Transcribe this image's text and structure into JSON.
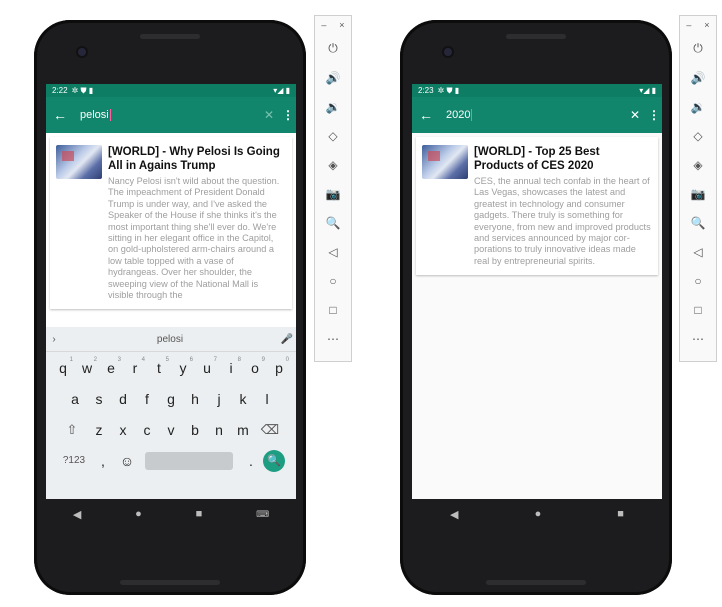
{
  "left_phone": {
    "status": {
      "time": "2:22",
      "left_icons": "✲ ⛊ ▮",
      "right_icons": "▾◢ ▮"
    },
    "search": {
      "query": "pelosi"
    },
    "article": {
      "title": "[WORLD] - Why Pelosi Is Going All in Agains Trump",
      "body": "Nancy Pelosi isn't wild about the question. The impeachment of President Donald Trump is under way, and I've asked the Speaker of the House if she thinks it's the most important thing she'll ever do. We're sitting in her elegant office in the Capitol, on gold-upholstered arm-chairs around a low table topped with a vase of hydrangeas. Over her shoulder, the sweeping view of the National Mall is visible through the"
    },
    "keyboard": {
      "suggestion": "pelosi",
      "row1": [
        "q",
        "w",
        "e",
        "r",
        "t",
        "y",
        "u",
        "i",
        "o",
        "p"
      ],
      "row1_hints": [
        "1",
        "2",
        "3",
        "4",
        "5",
        "6",
        "7",
        "8",
        "9",
        "0"
      ],
      "row2": [
        "a",
        "s",
        "d",
        "f",
        "g",
        "h",
        "j",
        "k",
        "l"
      ],
      "row3": [
        "z",
        "x",
        "c",
        "v",
        "b",
        "n",
        "m"
      ],
      "shift": "⇧",
      "backspace": "⌫",
      "symbols": "?123",
      "comma": ",",
      "emoji": "☺",
      "period": ".",
      "search": "🔍"
    }
  },
  "right_phone": {
    "status": {
      "time": "2:23",
      "left_icons": "✲ ⛊ ▮",
      "right_icons": "▾◢ ▮"
    },
    "search": {
      "query": "2020"
    },
    "article": {
      "title": "[WORLD] - Top 25 Best Products of CES 2020",
      "body": "CES, the annual tech confab in the heart of Las Vegas, showcases the latest and greatest in technology and consumer gadgets. There truly is something for everyone, from new and improved products and services announced by major cor-porations to truly innovative ideas made real by entrepreneurial spirits."
    }
  },
  "common": {
    "back": "←",
    "clear": "✕",
    "more": "⋮",
    "nav": {
      "back": "◀",
      "home": "●",
      "recents": "■",
      "keyboard": "⌨"
    }
  },
  "emulator_toolbar": {
    "minimize": "–",
    "close": "×",
    "icons": [
      "⏻",
      "🔊",
      "🔉",
      "◇",
      "◈",
      "📷",
      "🔍",
      "◁",
      "○",
      "□",
      "⋯"
    ]
  }
}
